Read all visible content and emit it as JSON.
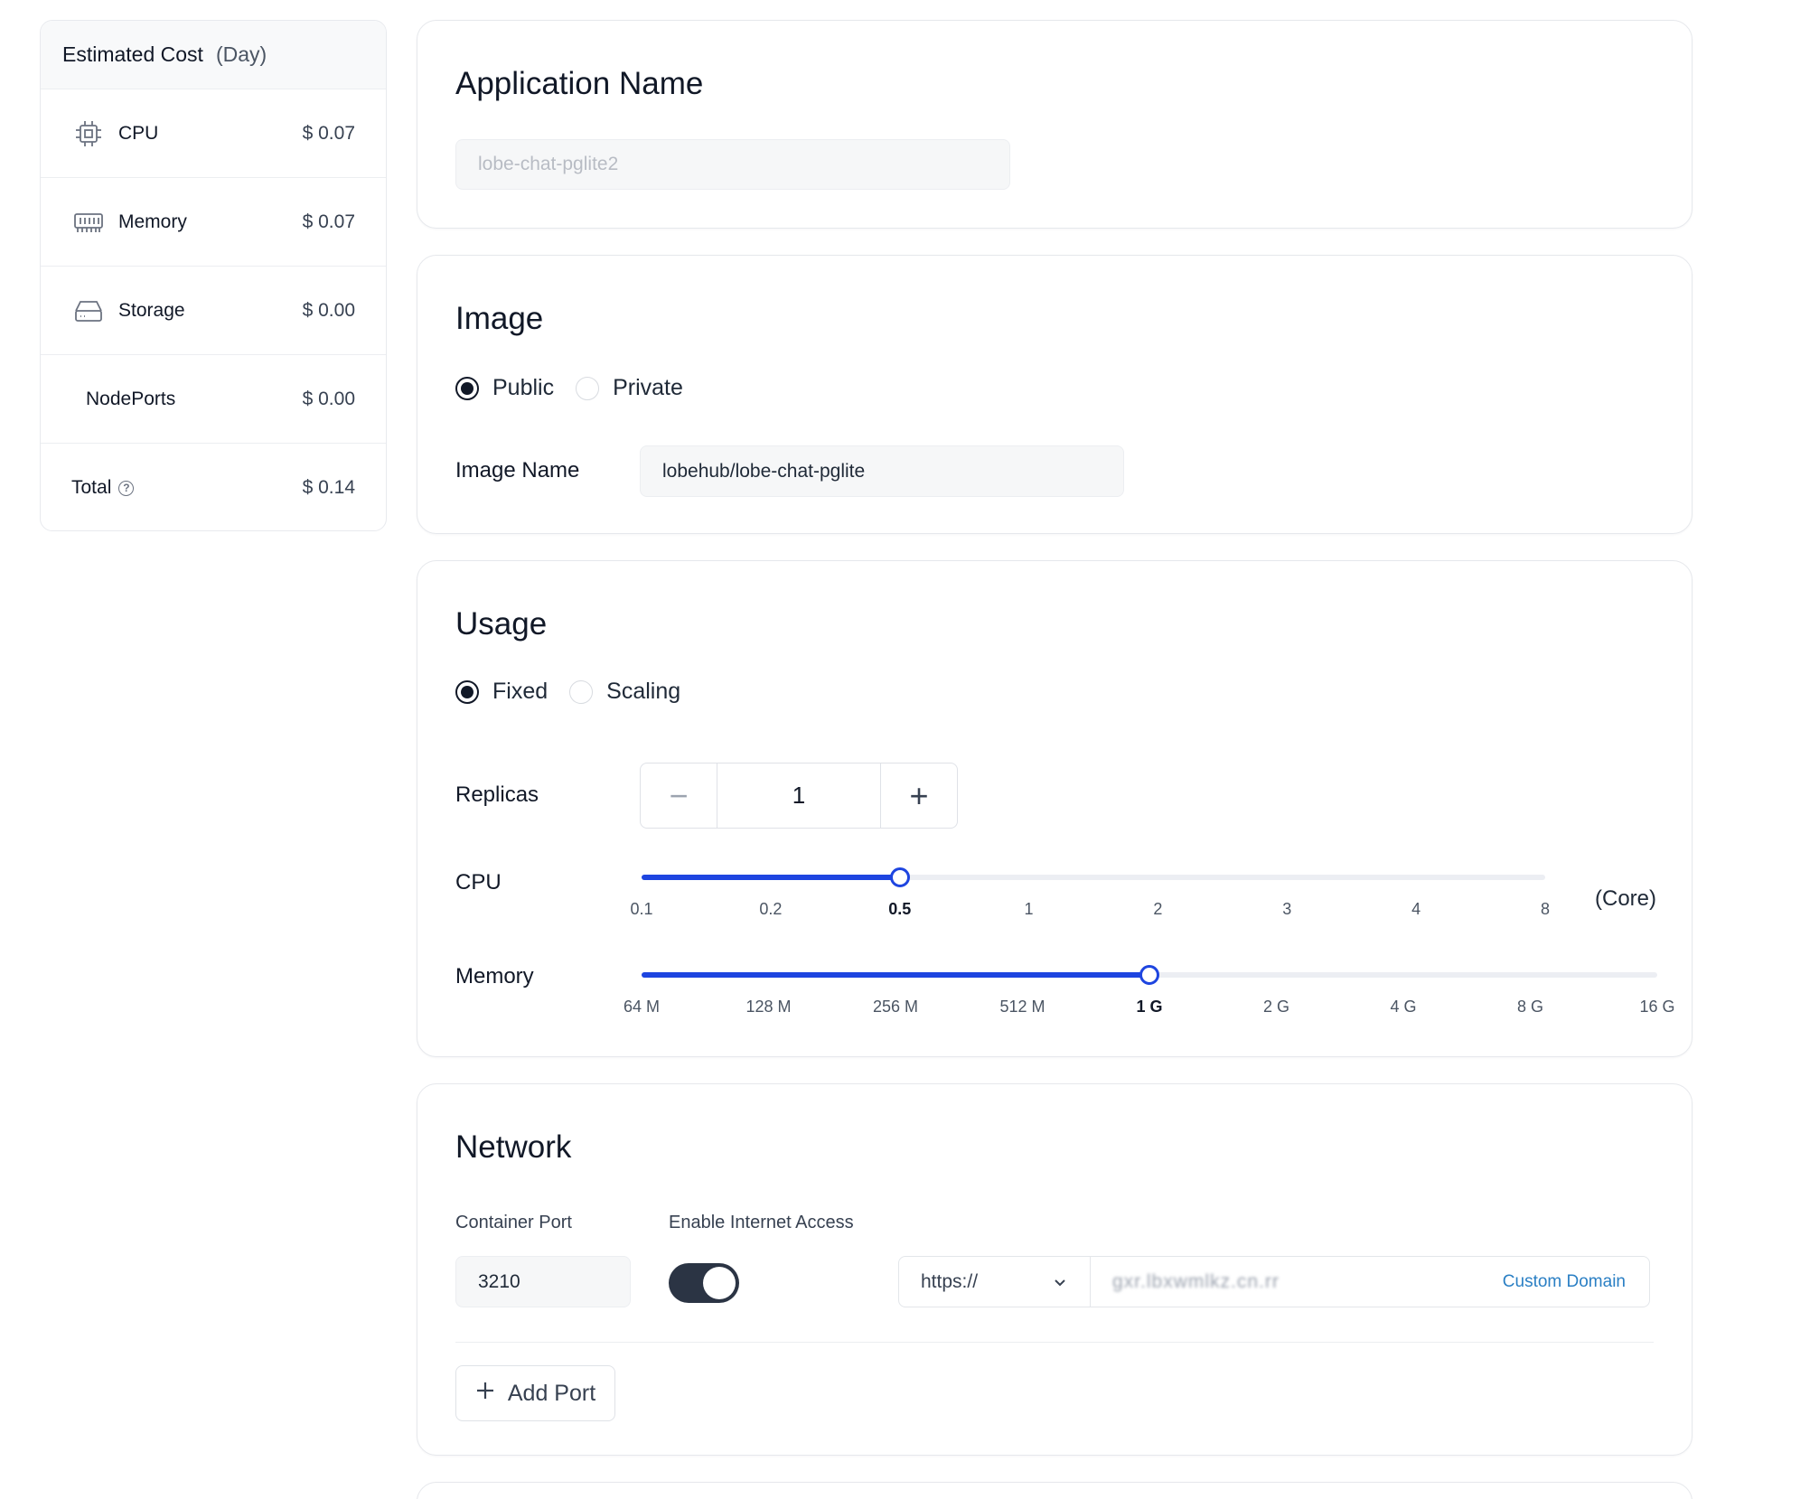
{
  "cost": {
    "title": "Estimated Cost",
    "unit": "(Day)",
    "items": [
      {
        "label": "CPU",
        "price": "$ 0.07",
        "icon": "cpu-icon"
      },
      {
        "label": "Memory",
        "price": "$ 0.07",
        "icon": "memory-icon"
      },
      {
        "label": "Storage",
        "price": "$ 0.00",
        "icon": "storage-icon"
      },
      {
        "label": "NodePorts",
        "price": "$ 0.00",
        "icon": ""
      },
      {
        "label": "Total",
        "price": "$ 0.14",
        "icon": "help-icon"
      }
    ]
  },
  "app_name": {
    "title": "Application Name",
    "value": "lobe-chat-pglite2"
  },
  "image": {
    "title": "Image",
    "options": [
      "Public",
      "Private"
    ],
    "selected": "Public",
    "name_label": "Image Name",
    "name_value": "lobehub/lobe-chat-pglite"
  },
  "usage": {
    "title": "Usage",
    "options": [
      "Fixed",
      "Scaling"
    ],
    "selected": "Fixed",
    "replicas_label": "Replicas",
    "replicas_value": "1",
    "minus": "−",
    "plus": "+",
    "cpu": {
      "label": "CPU",
      "ticks": [
        "0.1",
        "0.2",
        "0.5",
        "1",
        "2",
        "3",
        "4",
        "8"
      ],
      "selected": "0.5",
      "unit": "(Core)"
    },
    "memory": {
      "label": "Memory",
      "ticks": [
        "64 M",
        "128 M",
        "256 M",
        "512 M",
        "1 G",
        "2 G",
        "4 G",
        "8 G",
        "16 G"
      ],
      "selected": "1 G"
    }
  },
  "network": {
    "title": "Network",
    "container_port_label": "Container Port",
    "container_port_value": "3210",
    "internet_label": "Enable Internet Access",
    "internet_enabled": true,
    "protocol": "https://",
    "domain_value": "gxr.lbxwmlkz.cn.rr",
    "custom_domain": "Custom Domain",
    "add_port": "Add Port"
  },
  "colors": {
    "accent": "#1e45e0",
    "toggle_on": "#2b3444",
    "link": "#2a7fc4"
  }
}
